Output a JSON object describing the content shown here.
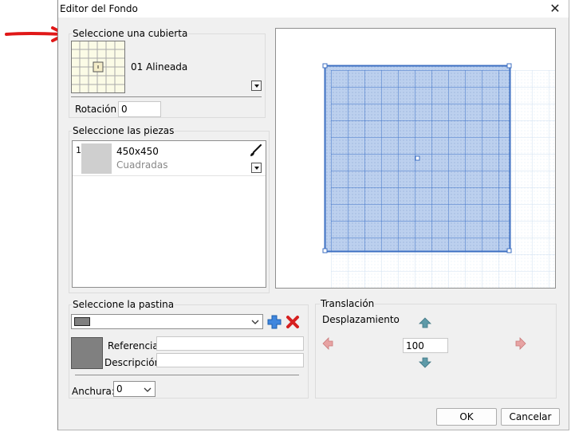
{
  "dialog": {
    "title": "Editor del Fondo",
    "close_glyph": "✕",
    "ok_label": "OK",
    "cancel_label": "Cancelar"
  },
  "cubierta": {
    "group_label": "Seleccione una cubierta",
    "selected_name": "01 Alineada",
    "rotation_label": "Rotación",
    "rotation_value": "0"
  },
  "piezas": {
    "group_label": "Seleccione las piezas",
    "items": [
      {
        "index": "1",
        "size": "450x450",
        "type": "Cuadradas"
      }
    ]
  },
  "pastina": {
    "group_label": "Seleccione la pastina",
    "reference_label": "Referencia",
    "reference_value": "",
    "description_label": "Descripción",
    "description_value": "",
    "width_label": "Anchura:",
    "width_value": "0",
    "swatch_color": "#808080"
  },
  "traslacion": {
    "group_label": "Translación",
    "displacement_label": "Desplazamiento",
    "displacement_value": "100"
  },
  "icons": {
    "annotation": "red-arrow-icon",
    "close": "close-icon",
    "brush": "brush-icon",
    "add": "add-plus-icon",
    "delete": "delete-x-icon",
    "up": "arrow-up-icon",
    "down": "arrow-down-icon",
    "left": "arrow-left-icon",
    "right": "arrow-right-icon"
  },
  "colors": {
    "accent_blue": "#4a7fd0",
    "tile_fill": "#bcd0ee",
    "thumb_fill": "#fbfbe6",
    "delete_red": "#d62020",
    "nav_teal": "#5e9aa8",
    "nav_disabled": "#e7a3a3"
  }
}
